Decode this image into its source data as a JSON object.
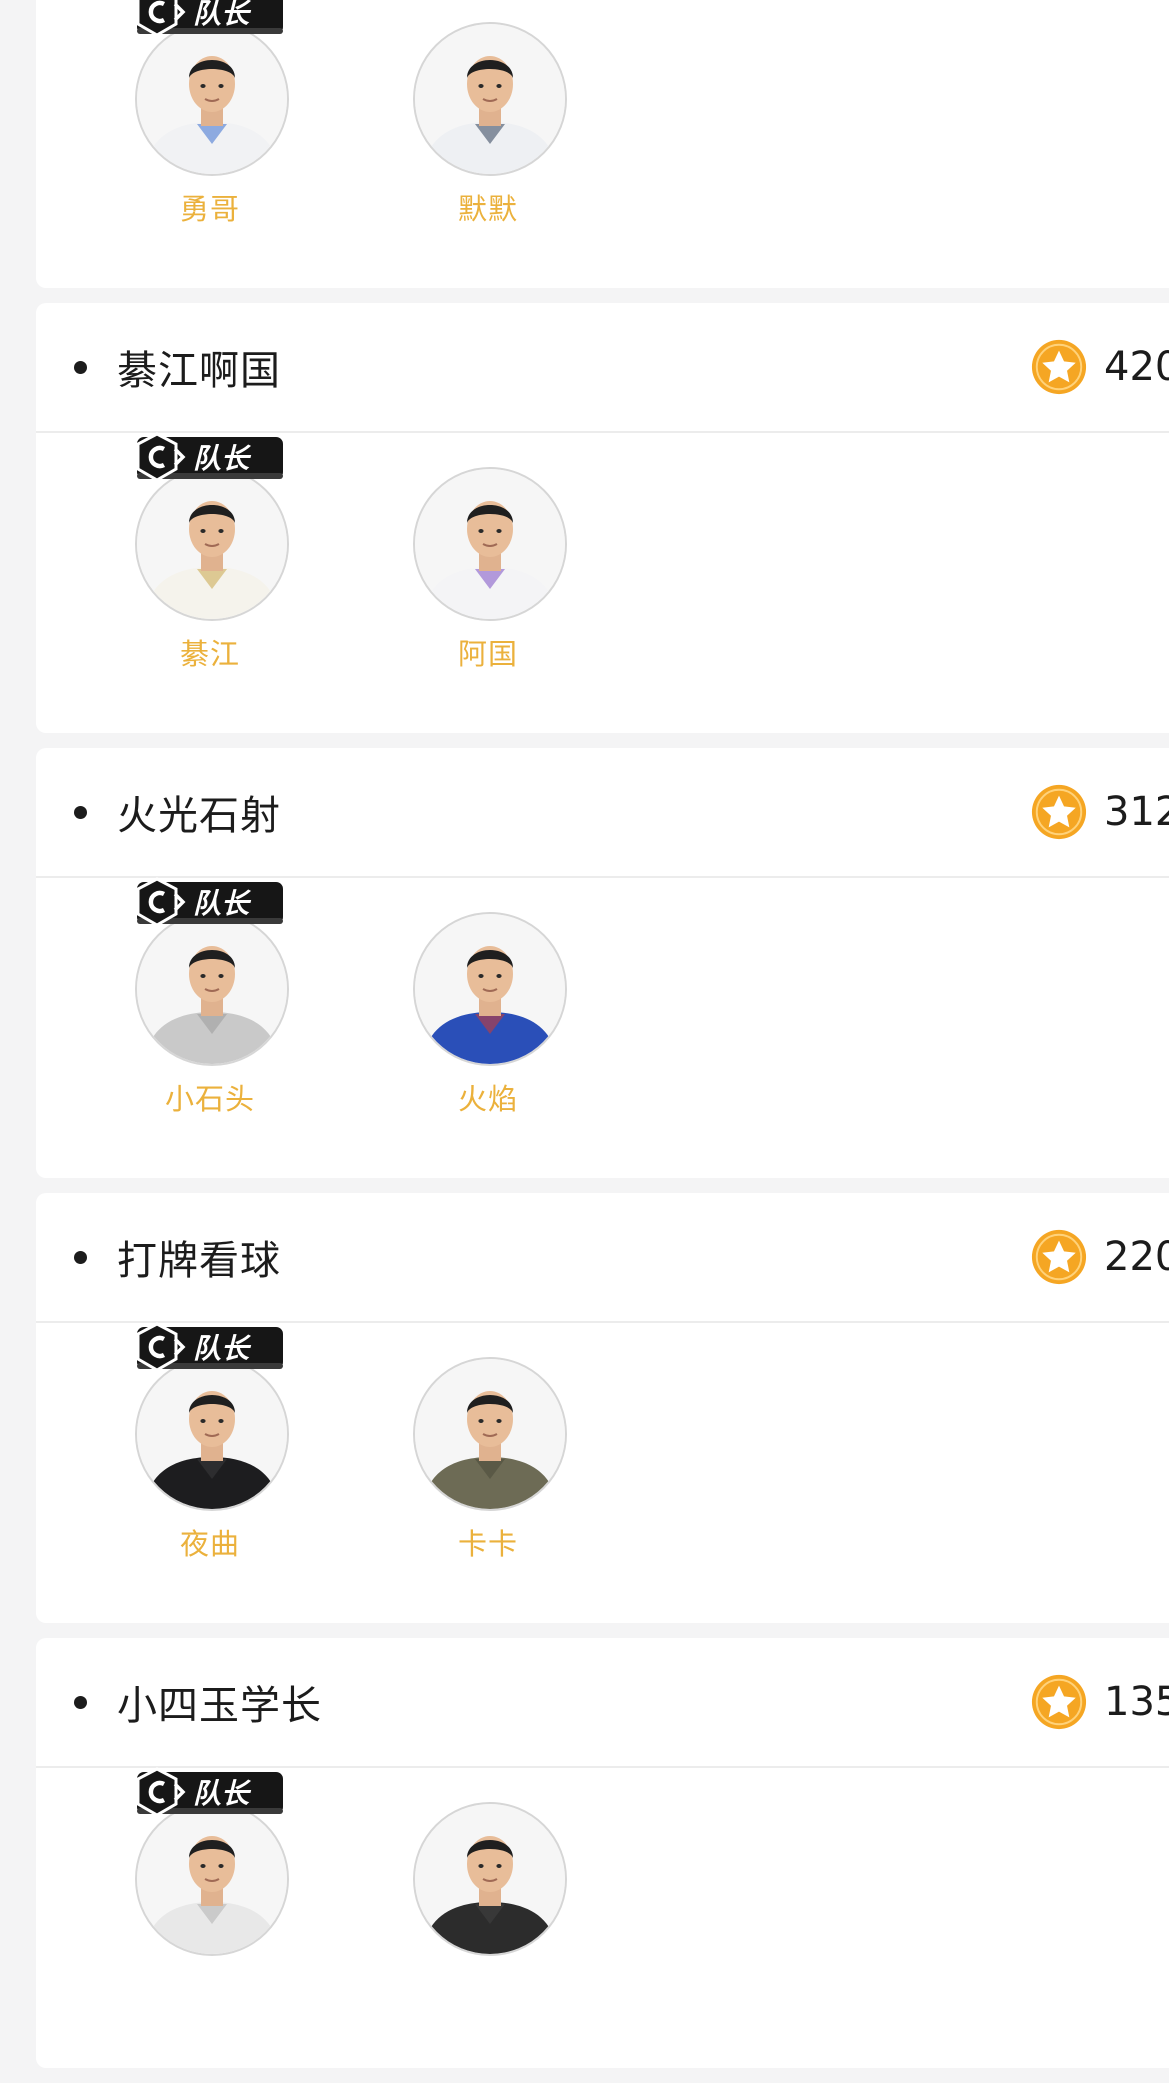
{
  "teams": [
    {
      "name": "",
      "score": "",
      "members": [
        {
          "name": "勇哥",
          "captain": true,
          "shirt": "#f1f2f4",
          "accent": "#3b6fd0"
        },
        {
          "name": "默默",
          "captain": false,
          "shirt": "#eef0f3",
          "accent": "#2f3f58"
        }
      ]
    },
    {
      "name": "綦江啊国",
      "score": "420",
      "members": [
        {
          "name": "綦江",
          "captain": true,
          "shirt": "#f5f3ec",
          "accent": "#c9a64a"
        },
        {
          "name": "阿国",
          "captain": false,
          "shirt": "#f4f4f6",
          "accent": "#7b4fc4"
        }
      ]
    },
    {
      "name": "火光石射",
      "score": "312",
      "members": [
        {
          "name": "小石头",
          "captain": true,
          "shirt": "#c9c9c9",
          "accent": "#9a9a9a"
        },
        {
          "name": "火焰",
          "captain": false,
          "shirt": "#2a4fb8",
          "accent": "#d23a2e"
        }
      ]
    },
    {
      "name": "打牌看球",
      "score": "220",
      "members": [
        {
          "name": "夜曲",
          "captain": true,
          "shirt": "#1d1d1f",
          "accent": "#3a3a3c"
        },
        {
          "name": "卡卡",
          "captain": false,
          "shirt": "#6d6b55",
          "accent": "#4b4a3a"
        }
      ]
    },
    {
      "name": "小四玉学长",
      "score": "135",
      "members": [
        {
          "name": "",
          "captain": true,
          "shirt": "#e8e8e8",
          "accent": "#b0b0b0"
        },
        {
          "name": "",
          "captain": false,
          "shirt": "#2c2c2c",
          "accent": "#444444"
        }
      ]
    }
  ],
  "captain_badge_text": "队长",
  "icons": {
    "score": "star-medal-icon",
    "captain": "captain-badge-icon"
  },
  "colors": {
    "accent_name": "#ebb13c",
    "star": "#f5a623",
    "page_background": "#f4f4f5",
    "card_background": "#ffffff"
  }
}
